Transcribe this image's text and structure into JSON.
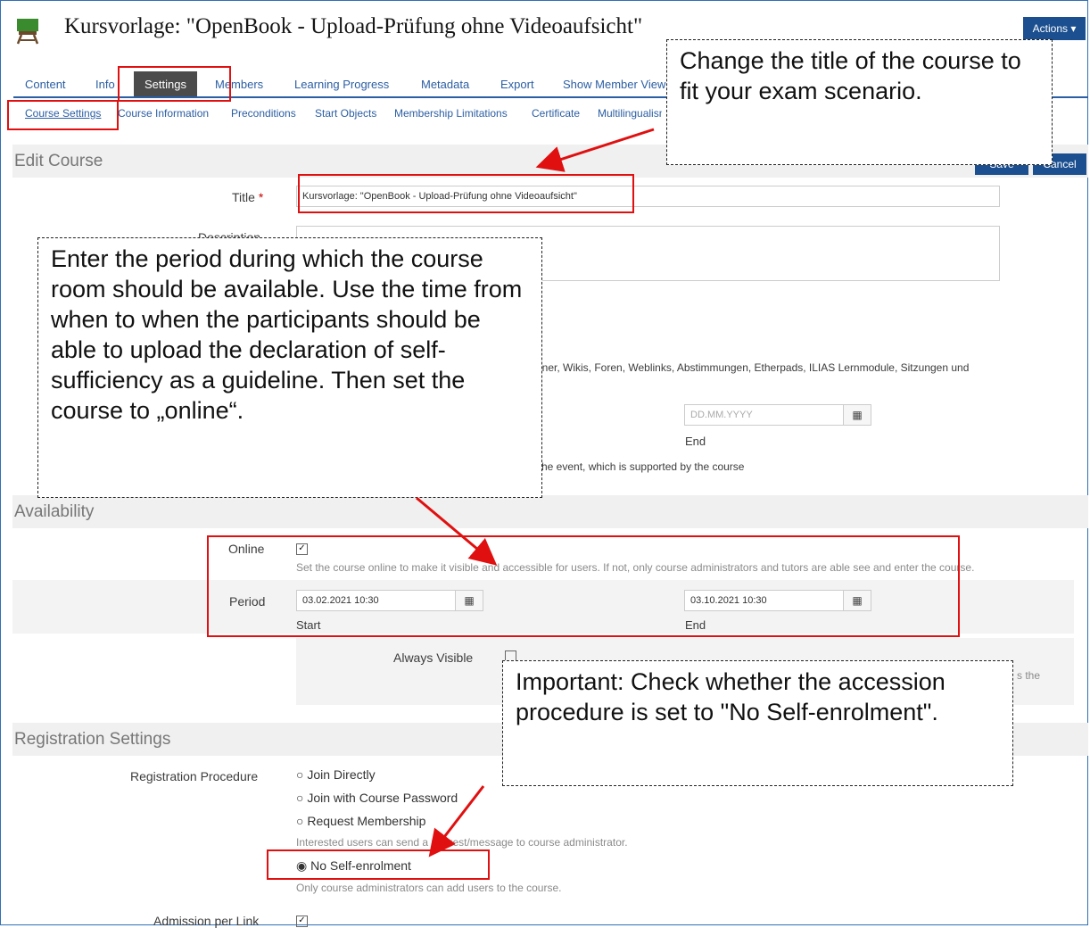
{
  "header": {
    "course_title": "Kursvorlage: \"OpenBook - Upload-Prüfung ohne Videoaufsicht\"",
    "actions_label": "Actions ▾"
  },
  "tabs": [
    "Content",
    "Info",
    "Settings",
    "Members",
    "Learning Progress",
    "Metadata",
    "Export",
    "Show Member View"
  ],
  "subtabs": [
    "Course Settings",
    "Course Information",
    "Preconditions",
    "Start Objects",
    "Membership Limitations",
    "Certificate",
    "Multilingualism"
  ],
  "edit_course": {
    "section": "Edit Course",
    "save_label": "Save",
    "cancel_label": "Cancel",
    "title_label": "Title",
    "required_mark": "*",
    "title_value": "Kursvorlage: \"OpenBook - Upload-Prüfung ohne Videoaufsicht\"",
    "desc_label_partial": "Description",
    "content_fragment": "rdner, Wikis, Foren, Weblinks, Abstimmungen, Etherpads, ILIAS Lernmodule, Sitzungen und",
    "date_placeholder": "DD.MM.YYYY",
    "end_label": "End",
    "event_fragment": "he event, which is supported by the course"
  },
  "availability": {
    "section": "Availability",
    "online_label": "Online",
    "online_checked": true,
    "online_desc": "Set the course online to make it visible and accessible for users. If not, only course administrators and tutors are able see and enter the course.",
    "period_label": "Period",
    "start_value": "03.02.2021 10:30",
    "end_value": "03.10.2021 10:30",
    "start_label": "Start",
    "end_label": "End",
    "always_visible_label": "Always Visible",
    "always_visible_fragment": "s the"
  },
  "registration": {
    "section": "Registration Settings",
    "procedure_label": "Registration Procedure",
    "options": [
      "Join Directly",
      "Join with Course Password",
      "Request Membership"
    ],
    "request_desc": "Interested users can send a request/message to course administrator.",
    "no_self_enrolment": "No Self-enrolment",
    "no_self_desc": "Only course administrators can add users to the course.",
    "admission_label": "Admission per Link"
  },
  "callouts": {
    "title_note": "Change the title of the course to fit your exam scenario.",
    "period_note": "Enter the period during which the course room should be available. Use the time from when to when the participants should be able to upload the declaration of self-sufficiency as a guideline. Then set the course to „online“.",
    "registration_note": "Important: Check whether the accession procedure is set to \"No Self-enrolment\"."
  },
  "colors": {
    "accent": "#1b4f8f",
    "annotation": "#e01010"
  }
}
